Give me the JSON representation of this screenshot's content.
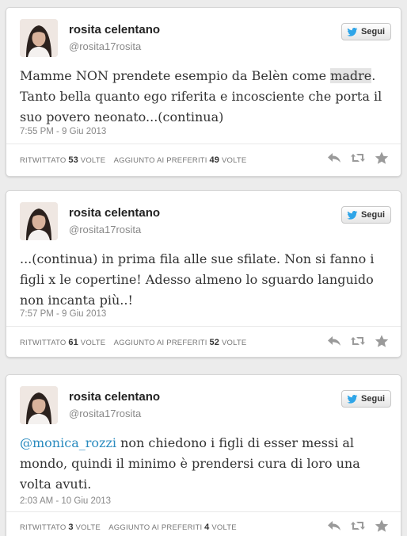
{
  "colors": {
    "accent": "#2a8bbf",
    "icon": "#9a9a9a",
    "twitter_bird": "#2fa5e8"
  },
  "tweets": [
    {
      "name": "rosita celentano",
      "handle": "@rosita17rosita",
      "follow_label": "Segui",
      "text_before": "Mamme NON prendete esempio da Belèn come ",
      "text_highlight": "madre",
      "text_after": ". Tanto bella quanto ego riferita e incosciente che porta il suo povero neonato...(continua)",
      "time": "7:55 PM - 9 Giu 2013",
      "retweet_label": "RITWITTATO",
      "retweet_count": "53",
      "retweet_unit": "VOLTE",
      "fav_label": "AGGIUNTO AI PREFERITI",
      "fav_count": "49",
      "fav_unit": "VOLTE"
    },
    {
      "name": "rosita celentano",
      "handle": "@rosita17rosita",
      "follow_label": "Segui",
      "text": "...(continua) in prima fila alle sue sfilate. Non si fanno i figli x le copertine! Adesso almeno lo sguardo languido non incanta più..!",
      "time": "7:57 PM - 9 Giu 2013",
      "retweet_label": "RITWITTATO",
      "retweet_count": "61",
      "retweet_unit": "VOLTE",
      "fav_label": "AGGIUNTO AI PREFERITI",
      "fav_count": "52",
      "fav_unit": "VOLTE"
    },
    {
      "name": "rosita celentano",
      "handle": "@rosita17rosita",
      "follow_label": "Segui",
      "mention": "@monica_rozzi",
      "text": " non chiedono i figli di esser messi al mondo, quindi il minimo è prendersi cura di loro una volta avuti.",
      "time": "2:03 AM - 10 Giu 2013",
      "retweet_label": "RITWITTATO",
      "retweet_count": "3",
      "retweet_unit": "VOLTE",
      "fav_label": "AGGIUNTO AI PREFERITI",
      "fav_count": "4",
      "fav_unit": "VOLTE"
    }
  ]
}
